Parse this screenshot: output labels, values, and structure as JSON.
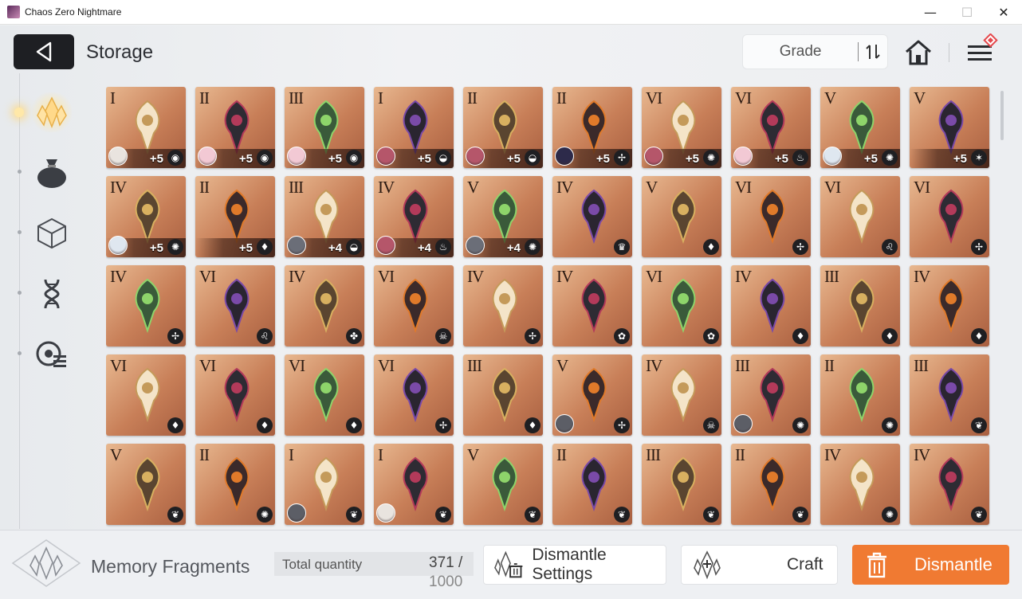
{
  "window": {
    "title": "Chaos Zero Nightmare",
    "minimize": "—",
    "maximize": "☐",
    "close": "✕"
  },
  "header": {
    "title": "Storage",
    "sort_label": "Grade",
    "back_icon": "back-arrow-icon",
    "home_icon": "home-icon",
    "menu_icon": "hamburger-menu-icon"
  },
  "sidebar": {
    "items": [
      {
        "icon": "memory-fragment-icon",
        "active": true
      },
      {
        "icon": "pouch-icon",
        "active": false
      },
      {
        "icon": "cube-icon",
        "active": false
      },
      {
        "icon": "dna-icon",
        "active": false
      },
      {
        "icon": "record-list-icon",
        "active": false
      }
    ]
  },
  "grid": {
    "rows": [
      [
        {
          "grade": "I",
          "plus": "+5",
          "type": "◉",
          "portrait": "#e9e4df"
        },
        {
          "grade": "II",
          "plus": "+5",
          "type": "◉",
          "portrait": "#f2c9d4"
        },
        {
          "grade": "III",
          "plus": "+5",
          "type": "◉",
          "portrait": "#f2c9d4"
        },
        {
          "grade": "I",
          "plus": "+5",
          "type": "◒",
          "portrait": "#b5566a"
        },
        {
          "grade": "II",
          "plus": "+5",
          "type": "◒",
          "portrait": "#b5566a"
        },
        {
          "grade": "II",
          "plus": "+5",
          "type": "✢",
          "portrait": "#2d2a4a"
        },
        {
          "grade": "VI",
          "plus": "+5",
          "type": "✺",
          "portrait": "#b5566a"
        },
        {
          "grade": "VI",
          "plus": "+5",
          "type": "♨",
          "portrait": "#f2c9d4"
        },
        {
          "grade": "V",
          "plus": "+5",
          "type": "✺",
          "portrait": "#dfe7f0"
        },
        {
          "grade": "V",
          "plus": "+5",
          "type": "✶",
          "portrait": ""
        }
      ],
      [
        {
          "grade": "IV",
          "plus": "+5",
          "type": "✺",
          "portrait": "#dfe7f0"
        },
        {
          "grade": "II",
          "plus": "+5",
          "type": "♦",
          "portrait": ""
        },
        {
          "grade": "III",
          "plus": "+4",
          "type": "◒",
          "portrait": "#6b6e78"
        },
        {
          "grade": "IV",
          "plus": "+4",
          "type": "♨",
          "portrait": "#b5566a"
        },
        {
          "grade": "V",
          "plus": "+4",
          "type": "✺",
          "portrait": "#6b6e78"
        },
        {
          "grade": "IV",
          "plus": "",
          "type": "♛",
          "portrait": ""
        },
        {
          "grade": "V",
          "plus": "",
          "type": "♦",
          "portrait": ""
        },
        {
          "grade": "VI",
          "plus": "",
          "type": "✢",
          "portrait": ""
        },
        {
          "grade": "VI",
          "plus": "",
          "type": "♌",
          "portrait": ""
        },
        {
          "grade": "VI",
          "plus": "",
          "type": "✢",
          "portrait": ""
        }
      ],
      [
        {
          "grade": "IV",
          "plus": "",
          "type": "✢",
          "portrait": ""
        },
        {
          "grade": "VI",
          "plus": "",
          "type": "♌",
          "portrait": ""
        },
        {
          "grade": "IV",
          "plus": "",
          "type": "✤",
          "portrait": ""
        },
        {
          "grade": "VI",
          "plus": "",
          "type": "☠",
          "portrait": ""
        },
        {
          "grade": "IV",
          "plus": "",
          "type": "✢",
          "portrait": ""
        },
        {
          "grade": "IV",
          "plus": "",
          "type": "✿",
          "portrait": ""
        },
        {
          "grade": "VI",
          "plus": "",
          "type": "✿",
          "portrait": ""
        },
        {
          "grade": "IV",
          "plus": "",
          "type": "♦",
          "portrait": ""
        },
        {
          "grade": "III",
          "plus": "",
          "type": "♦",
          "portrait": ""
        },
        {
          "grade": "IV",
          "plus": "",
          "type": "♦",
          "portrait": ""
        }
      ],
      [
        {
          "grade": "VI",
          "plus": "",
          "type": "♦",
          "portrait": ""
        },
        {
          "grade": "VI",
          "plus": "",
          "type": "♦",
          "portrait": ""
        },
        {
          "grade": "VI",
          "plus": "",
          "type": "♦",
          "portrait": ""
        },
        {
          "grade": "VI",
          "plus": "",
          "type": "✢",
          "portrait": ""
        },
        {
          "grade": "III",
          "plus": "",
          "type": "♦",
          "portrait": ""
        },
        {
          "grade": "V",
          "plus": "",
          "type": "✢",
          "portrait": "#5c5e66"
        },
        {
          "grade": "IV",
          "plus": "",
          "type": "☠",
          "portrait": ""
        },
        {
          "grade": "III",
          "plus": "",
          "type": "✺",
          "portrait": "#5c5e66"
        },
        {
          "grade": "II",
          "plus": "",
          "type": "✺",
          "portrait": ""
        },
        {
          "grade": "III",
          "plus": "",
          "type": "❦",
          "portrait": ""
        }
      ],
      [
        {
          "grade": "V",
          "plus": "",
          "type": "❦",
          "portrait": ""
        },
        {
          "grade": "II",
          "plus": "",
          "type": "✺",
          "portrait": ""
        },
        {
          "grade": "I",
          "plus": "",
          "type": "❦",
          "portrait": "#5c5e66"
        },
        {
          "grade": "I",
          "plus": "",
          "type": "❦",
          "portrait": "#e9e4df"
        },
        {
          "grade": "V",
          "plus": "",
          "type": "❦",
          "portrait": ""
        },
        {
          "grade": "II",
          "plus": "",
          "type": "❦",
          "portrait": ""
        },
        {
          "grade": "III",
          "plus": "",
          "type": "❦",
          "portrait": ""
        },
        {
          "grade": "II",
          "plus": "",
          "type": "❦",
          "portrait": ""
        },
        {
          "grade": "IV",
          "plus": "",
          "type": "✺",
          "portrait": ""
        },
        {
          "grade": "IV",
          "plus": "",
          "type": "❦",
          "portrait": ""
        }
      ]
    ]
  },
  "footer": {
    "section_title": "Memory Fragments",
    "total_label": "Total quantity",
    "total_value": "371 /",
    "total_max": "1000",
    "dismantle_settings_label": "Dismantle Settings",
    "craft_label": "Craft",
    "dismantle_label": "Dismantle",
    "accent_color": "#f07a32"
  }
}
